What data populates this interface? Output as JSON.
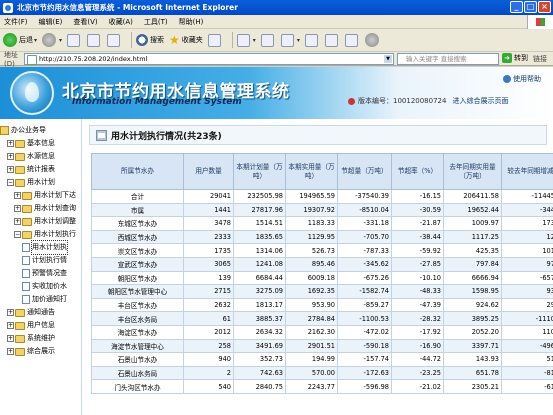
{
  "window": {
    "title": "北京市节约用水信息管理系统 - Microsoft Internet Explorer",
    "btn_min": "_",
    "btn_max": "□",
    "btn_close": "×"
  },
  "menu": [
    "文件(F)",
    "编辑(E)",
    "查看(V)",
    "收藏(A)",
    "工具(T)",
    "帮助(H)"
  ],
  "toolbar": {
    "back": "后退",
    "search": "搜索",
    "favorites": "收藏夹"
  },
  "address": {
    "label": "地址(D)",
    "url": "http://210.75.208.202/index.html",
    "keyword_placeholder": "输入关键字 直接搜索",
    "go": "转到",
    "links": "链接"
  },
  "banner": {
    "title": "北京市节约用水信息管理系统",
    "subtitle": "Information Management System",
    "help": "使用帮助",
    "version": "版本编号：100120080724",
    "enter": "进入综合展示页面"
  },
  "nav": [
    {
      "label": "办公业务导",
      "level": 0,
      "kind": "home"
    },
    {
      "label": "基本信息",
      "level": 1,
      "kind": "folder",
      "exp": "+"
    },
    {
      "label": "水源信息",
      "level": 1,
      "kind": "folder",
      "exp": "+"
    },
    {
      "label": "统计报表",
      "level": 1,
      "kind": "folder",
      "exp": "+"
    },
    {
      "label": "用水计划",
      "level": 1,
      "kind": "folder",
      "exp": "−"
    },
    {
      "label": "用水计划下达",
      "level": 2,
      "kind": "folder",
      "exp": "+"
    },
    {
      "label": "用水计划查询",
      "level": 2,
      "kind": "folder",
      "exp": "+"
    },
    {
      "label": "用水计划调整",
      "level": 2,
      "kind": "folder",
      "exp": "+"
    },
    {
      "label": "用水计划执行",
      "level": 2,
      "kind": "folder",
      "exp": "−"
    },
    {
      "label": "用水计划执",
      "level": 3,
      "kind": "page",
      "selected": true
    },
    {
      "label": "计划执行情",
      "level": 3,
      "kind": "page"
    },
    {
      "label": "预警情况查",
      "level": 3,
      "kind": "page"
    },
    {
      "label": "实收加价水",
      "level": 3,
      "kind": "page"
    },
    {
      "label": "加价通知打",
      "level": 3,
      "kind": "page"
    },
    {
      "label": "通知通告",
      "level": 1,
      "kind": "folder",
      "exp": "+"
    },
    {
      "label": "用户信息",
      "level": 1,
      "kind": "folder",
      "exp": "+"
    },
    {
      "label": "系统维护",
      "level": 1,
      "kind": "folder",
      "exp": "+"
    },
    {
      "label": "综合展示",
      "level": 1,
      "kind": "folder",
      "exp": "+"
    }
  ],
  "main": {
    "title": "用水计划执行情况(共23条)"
  },
  "table": {
    "headers": [
      "所属节水办",
      "用户数量",
      "本期计划量（万吨）",
      "本期实用量（万吨）",
      "节超量（万吨）",
      "节超率（%）",
      "去年同期实用量（万吨）",
      "较去年同期增减"
    ],
    "rows": [
      [
        "合计",
        "29041",
        "232505.98",
        "194965.59",
        "-37540.39",
        "-16.15",
        "206411.58",
        "-11445."
      ],
      [
        "市属",
        "1441",
        "27817.96",
        "19307.92",
        "-8510.04",
        "-30.59",
        "19652.44",
        "-344."
      ],
      [
        "东城区节水办",
        "3478",
        "1514.51",
        "1183.33",
        "-331.18",
        "-21.87",
        "1009.97",
        "173."
      ],
      [
        "西城区节水办",
        "2333",
        "1835.65",
        "1129.95",
        "-705.70",
        "-38.44",
        "1117.25",
        "12."
      ],
      [
        "崇文区节水办",
        "1735",
        "1314.06",
        "526.73",
        "-787.33",
        "-59.92",
        "425.35",
        "101."
      ],
      [
        "宣武区节水办",
        "3065",
        "1241.08",
        "895.46",
        "-345.62",
        "-27.85",
        "797.84",
        "97."
      ],
      [
        "朝阳区节水办",
        "139",
        "6684.44",
        "6009.18",
        "-675.26",
        "-10.10",
        "6666.94",
        "-657."
      ],
      [
        "朝阳区节水管理中心",
        "2715",
        "3275.09",
        "1692.35",
        "-1582.74",
        "-48.33",
        "1598.95",
        "93."
      ],
      [
        "丰台区节水办",
        "2632",
        "1813.17",
        "953.90",
        "-859.27",
        "-47.39",
        "924.62",
        "29."
      ],
      [
        "丰台区水务局",
        "61",
        "3885.37",
        "2784.84",
        "-1100.53",
        "-28.32",
        "3895.25",
        "-1110."
      ],
      [
        "海淀区节水办",
        "2012",
        "2634.32",
        "2162.30",
        "-472.02",
        "-17.92",
        "2052.20",
        "110."
      ],
      [
        "海淀节水管理中心",
        "258",
        "3491.69",
        "2901.51",
        "-590.18",
        "-16.90",
        "3397.71",
        "-496."
      ],
      [
        "石景山节水办",
        "940",
        "352.73",
        "194.99",
        "-157.74",
        "-44.72",
        "143.93",
        "51."
      ],
      [
        "石景山水务局",
        "2",
        "742.63",
        "570.00",
        "-172.63",
        "-23.25",
        "651.78",
        "-81."
      ],
      [
        "门头沟区节水办",
        "540",
        "2840.75",
        "2243.77",
        "-596.98",
        "-21.02",
        "2305.21",
        "-61."
      ]
    ]
  }
}
